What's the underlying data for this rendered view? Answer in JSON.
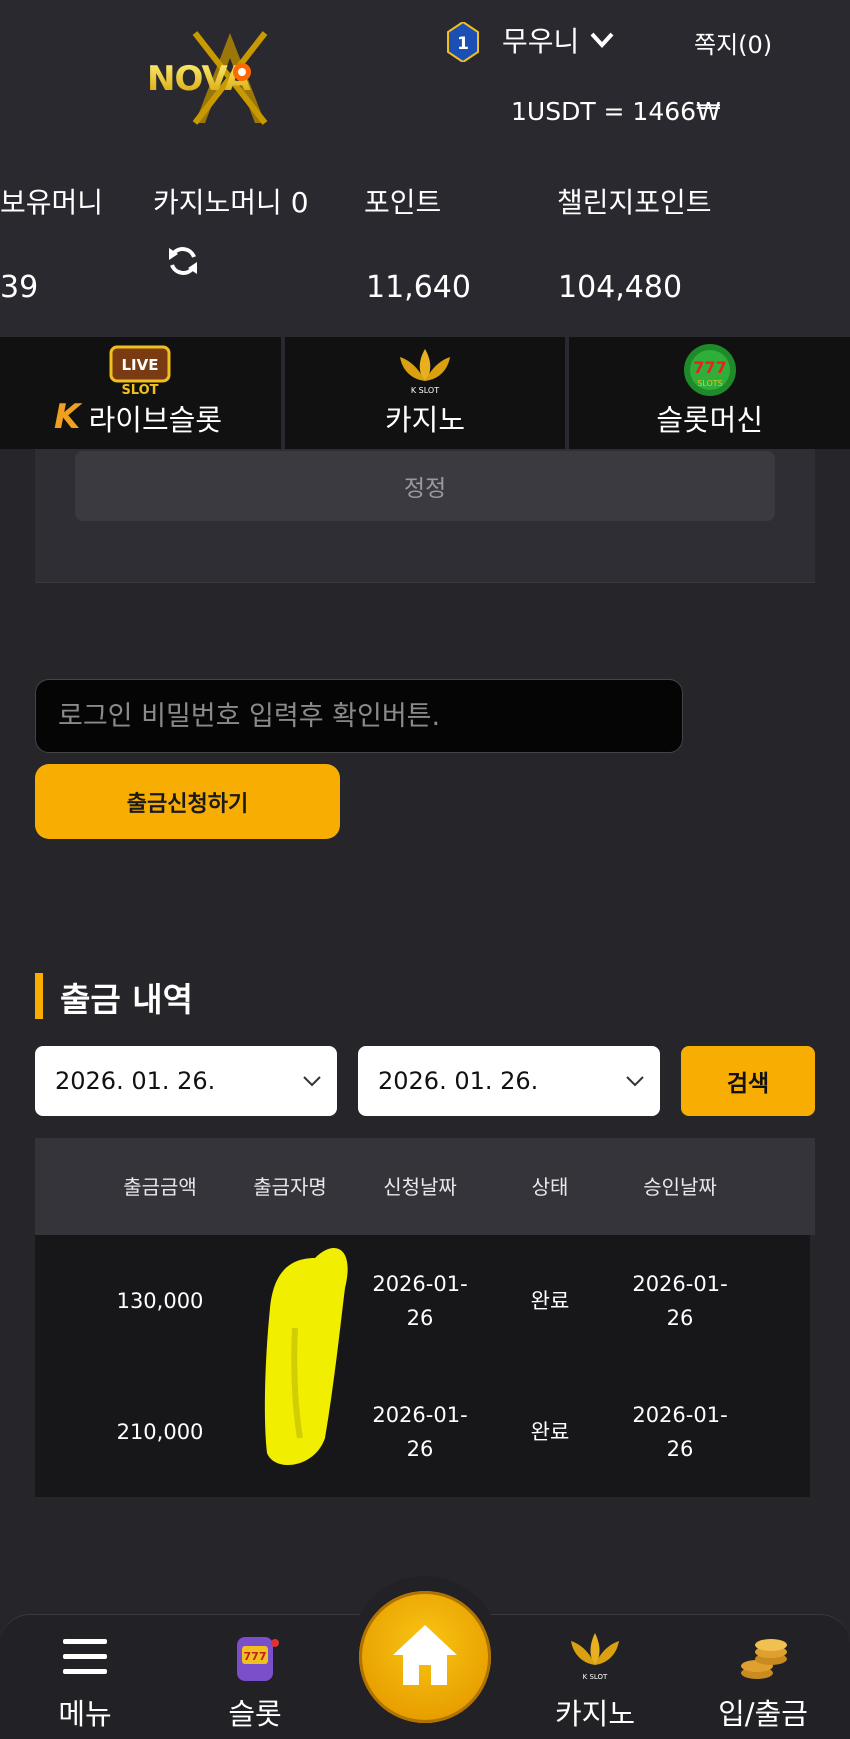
{
  "header": {
    "logo_text": "NOVA",
    "level": "1",
    "username": "무우니",
    "messages": "쪽지(0)",
    "rate": "1USDT = 1466₩"
  },
  "balances": {
    "holding_label": "보유머니",
    "holding_value": "39",
    "casino_label": "카지노머니 0",
    "point_label": "포인트",
    "point_value": "11,640",
    "challenge_label": "챌린지포인트",
    "challenge_value": "104,480"
  },
  "nav": {
    "items": [
      {
        "label": "라이브슬롯",
        "icon": "live-slot-icon",
        "icon_text": "LIVE SLOT"
      },
      {
        "label": "카지노",
        "icon": "k-slot-lotus-icon",
        "icon_text": "K SLOT"
      },
      {
        "label": "슬롯머신",
        "icon": "777-slots-icon",
        "icon_text": "777 SLOTS"
      }
    ]
  },
  "panel": {
    "button_label": "정정"
  },
  "withdraw": {
    "placeholder": "로그인 비밀번호 입력후 확인버튼.",
    "button_label": "출금신청하기"
  },
  "history": {
    "title": "출금 내역",
    "date_from": "2026. 01. 26.",
    "date_to": "2026. 01. 26.",
    "search_label": "검색",
    "columns": [
      "출금금액",
      "출금자명",
      "신청날짜",
      "상태",
      "승인날짜"
    ],
    "rows": [
      {
        "amount": "130,000",
        "name": "",
        "request_date": "2026-01-26",
        "status": "완료",
        "approve_date": "2026-01-26"
      },
      {
        "amount": "210,000",
        "name": "",
        "request_date": "2026-01-26",
        "status": "완료",
        "approve_date": "2026-01-26"
      }
    ]
  },
  "bottom_nav": {
    "menu": "메뉴",
    "slot": "슬롯",
    "casino": "카지노",
    "deposit": "입/출금"
  },
  "colors": {
    "accent": "#f7ad02",
    "background": "#26252a",
    "header": "#2a292f"
  }
}
